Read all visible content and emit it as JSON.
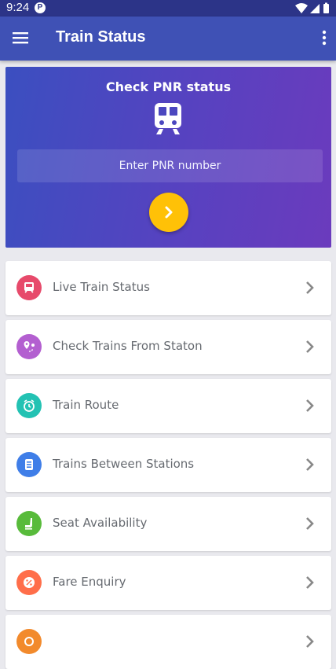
{
  "status_bar": {
    "time": "9:24",
    "notification_icon": "sync-icon"
  },
  "app_bar": {
    "title": "Train Status"
  },
  "pnr_card": {
    "title": "Check PNR status",
    "input_placeholder": "Enter PNR number"
  },
  "menu_items": [
    {
      "label": "Live Train Status",
      "icon": "live-train-icon",
      "color": "#e74a6b"
    },
    {
      "label": "Check Trains From Staton",
      "icon": "map-pin-icon",
      "color": "#b35fd0"
    },
    {
      "label": "Train Route",
      "icon": "clock-icon",
      "color": "#23c2b3"
    },
    {
      "label": "Trains Between Stations",
      "icon": "list-icon",
      "color": "#3f7ee8"
    },
    {
      "label": "Seat Availability",
      "icon": "seat-icon",
      "color": "#58bb3b"
    },
    {
      "label": "Fare Enquiry",
      "icon": "percent-icon",
      "color": "#ff6e4a"
    },
    {
      "label": "",
      "icon": "partial-icon",
      "color": "#f28a2c"
    }
  ],
  "colors": {
    "app_bar": "#3f51b5",
    "accent": "#ffc107",
    "background": "#e9e9ee"
  }
}
